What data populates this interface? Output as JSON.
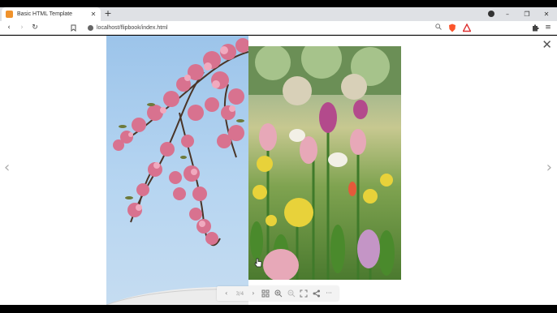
{
  "browser": {
    "tab_title": "Basic HTML Template",
    "tab_close": "✕",
    "new_tab": "+",
    "url": "localhost/flipbook/index.html",
    "window_controls": [
      "–",
      "❐",
      "✕"
    ]
  },
  "toolbar": {
    "back": "‹",
    "forward": "›",
    "reload": "↻",
    "menu": "≡"
  },
  "viewer": {
    "close": "✕",
    "prev_arrow": "‹",
    "next_arrow": "›"
  },
  "controls": {
    "prev": "‹",
    "page": "3/4",
    "next": "›",
    "thumbnails_icon": "grid-icon",
    "zoom_in_icon": "zoom-in-icon",
    "zoom_out_icon": "zoom-out-icon",
    "fullscreen_icon": "fullscreen-icon",
    "share_icon": "share-icon",
    "more": "···"
  },
  "pages": [
    {
      "name": "cherry-blossom-page"
    },
    {
      "name": "tulip-field-page"
    }
  ],
  "colors": {
    "tab_favicon": "#f0922b",
    "brave_shield": "#fb542b",
    "sky": "#9cc4ea"
  }
}
